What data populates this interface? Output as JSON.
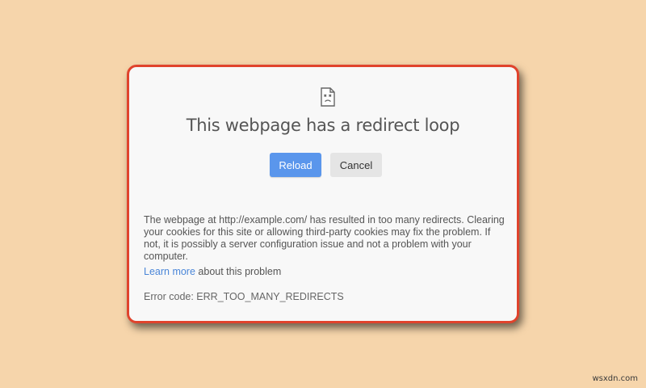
{
  "dialog": {
    "icon": "sad-page-icon",
    "title": "This webpage has a redirect loop",
    "buttons": {
      "reload_label": "Reload",
      "cancel_label": "Cancel"
    },
    "message": "The webpage at http://example.com/ has resulted in too many redirects. Clearing your cookies for this site or allowing third-party cookies may fix the problem. If not, it is possibly a server configuration issue and not a problem with your computer.",
    "learn_more": {
      "link_text": "Learn more",
      "suffix_text": " about this problem"
    },
    "error_code": "Error code: ERR_TOO_MANY_REDIRECTS"
  },
  "watermark": "wsxdn.com",
  "colors": {
    "background": "#f6d5ab",
    "dialog_border": "#e0432c",
    "reload_button": "#5a96ec",
    "link": "#4a86d8"
  }
}
